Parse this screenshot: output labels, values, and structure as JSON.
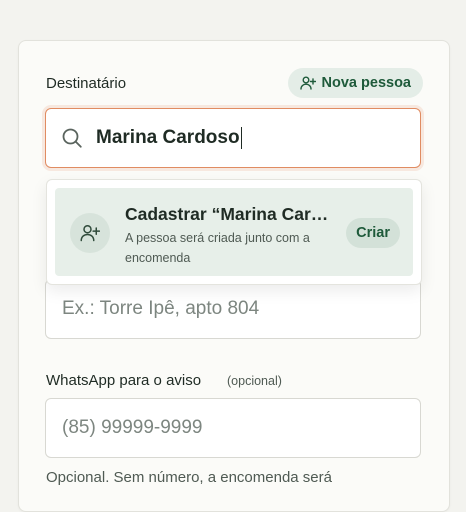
{
  "recipient": {
    "label": "Destinatário",
    "new_person_button": "Nova pessoa",
    "search_value": "Marina Cardoso"
  },
  "suggestion": {
    "title": "Cadastrar “Marina Cardoso”",
    "subtitle": "A pessoa será criada junto com a encomenda",
    "action": "Criar"
  },
  "unit": {
    "placeholder": "Ex.: Torre Ipê, apto 804"
  },
  "whatsapp": {
    "label": "WhatsApp para o aviso",
    "optional": "(opcional)",
    "placeholder": "(85) 99999-9999",
    "hint": "Opcional. Sem número, a encomenda será"
  },
  "icons": [
    "user-plus-icon",
    "search-icon"
  ],
  "colors": {
    "accent_green": "#1e5a3a",
    "focus_orange": "#e08c62",
    "suggestion_bg": "#e7efe9"
  }
}
